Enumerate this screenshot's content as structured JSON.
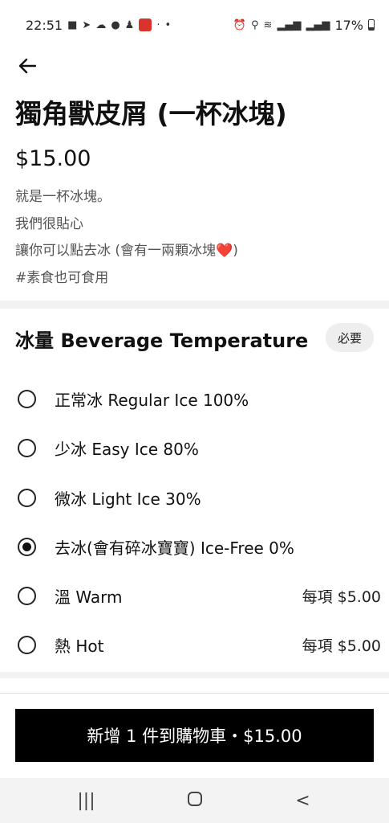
{
  "status_bar": {
    "time": "22:51",
    "battery": "17%"
  },
  "product": {
    "title": "獨角獸皮屑 (一杯冰塊)",
    "price": "$15.00",
    "description": [
      "就是一杯冰塊。",
      "我們很貼心",
      "讓你可以點去冰 (會有一兩顆冰塊",
      "#素食也可食用"
    ],
    "heart": "❤️"
  },
  "options_section": {
    "title": "冰量 Beverage Temperature",
    "required_label": "必要",
    "options": [
      {
        "label": "正常冰 Regular Ice 100%",
        "extra": "",
        "checked": false
      },
      {
        "label": "少冰 Easy Ice 80%",
        "extra": "",
        "checked": false
      },
      {
        "label": "微冰 Light Ice 30%",
        "extra": "",
        "checked": false
      },
      {
        "label": "去冰(會有碎冰寶寶) Ice-Free 0%",
        "extra": "",
        "checked": true
      },
      {
        "label": "溫 Warm",
        "extra": "每項 $5.00",
        "checked": false
      },
      {
        "label": "熱 Hot",
        "extra": "每項 $5.00",
        "checked": false
      }
    ]
  },
  "cart_button": {
    "label": "新增 1 件到購物車・$15.00"
  },
  "nav": {
    "recents": "|||",
    "back": "<"
  }
}
